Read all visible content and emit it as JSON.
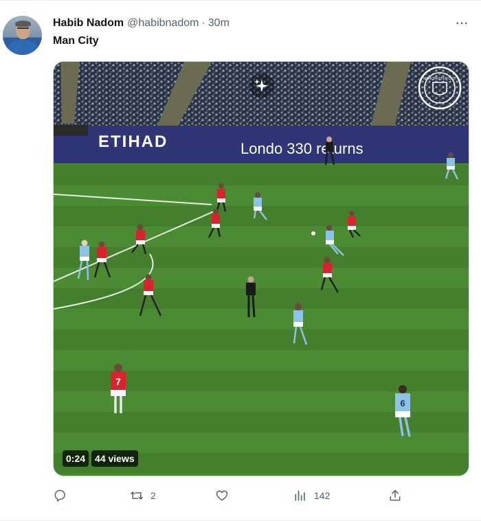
{
  "tweet": {
    "display_name": "Habib Nadom",
    "handle": "@habibnadom",
    "separator": "·",
    "time": "30m",
    "text": "Man City",
    "more_icon": "more-horizontal-icon"
  },
  "media": {
    "duration": "0:24",
    "views": "44 views",
    "board_text_1": "ETIHAD",
    "board_text_2": "Londo  330 returns",
    "crest_text": "MANCHESTER CITY",
    "jersey_numbers": [
      "7",
      "6"
    ]
  },
  "actions": {
    "reply": {
      "icon": "reply-icon",
      "count": ""
    },
    "retweet": {
      "icon": "retweet-icon",
      "count": "2"
    },
    "like": {
      "icon": "heart-icon",
      "count": ""
    },
    "views": {
      "icon": "views-chart-icon",
      "count": "142"
    },
    "share": {
      "icon": "share-icon",
      "count": ""
    }
  },
  "colors": {
    "text_primary": "#0f1419",
    "text_secondary": "#536471",
    "pitch_green": "#4a8a32",
    "arsenal_red": "#d8242d",
    "city_blue": "#8fc3e6"
  }
}
